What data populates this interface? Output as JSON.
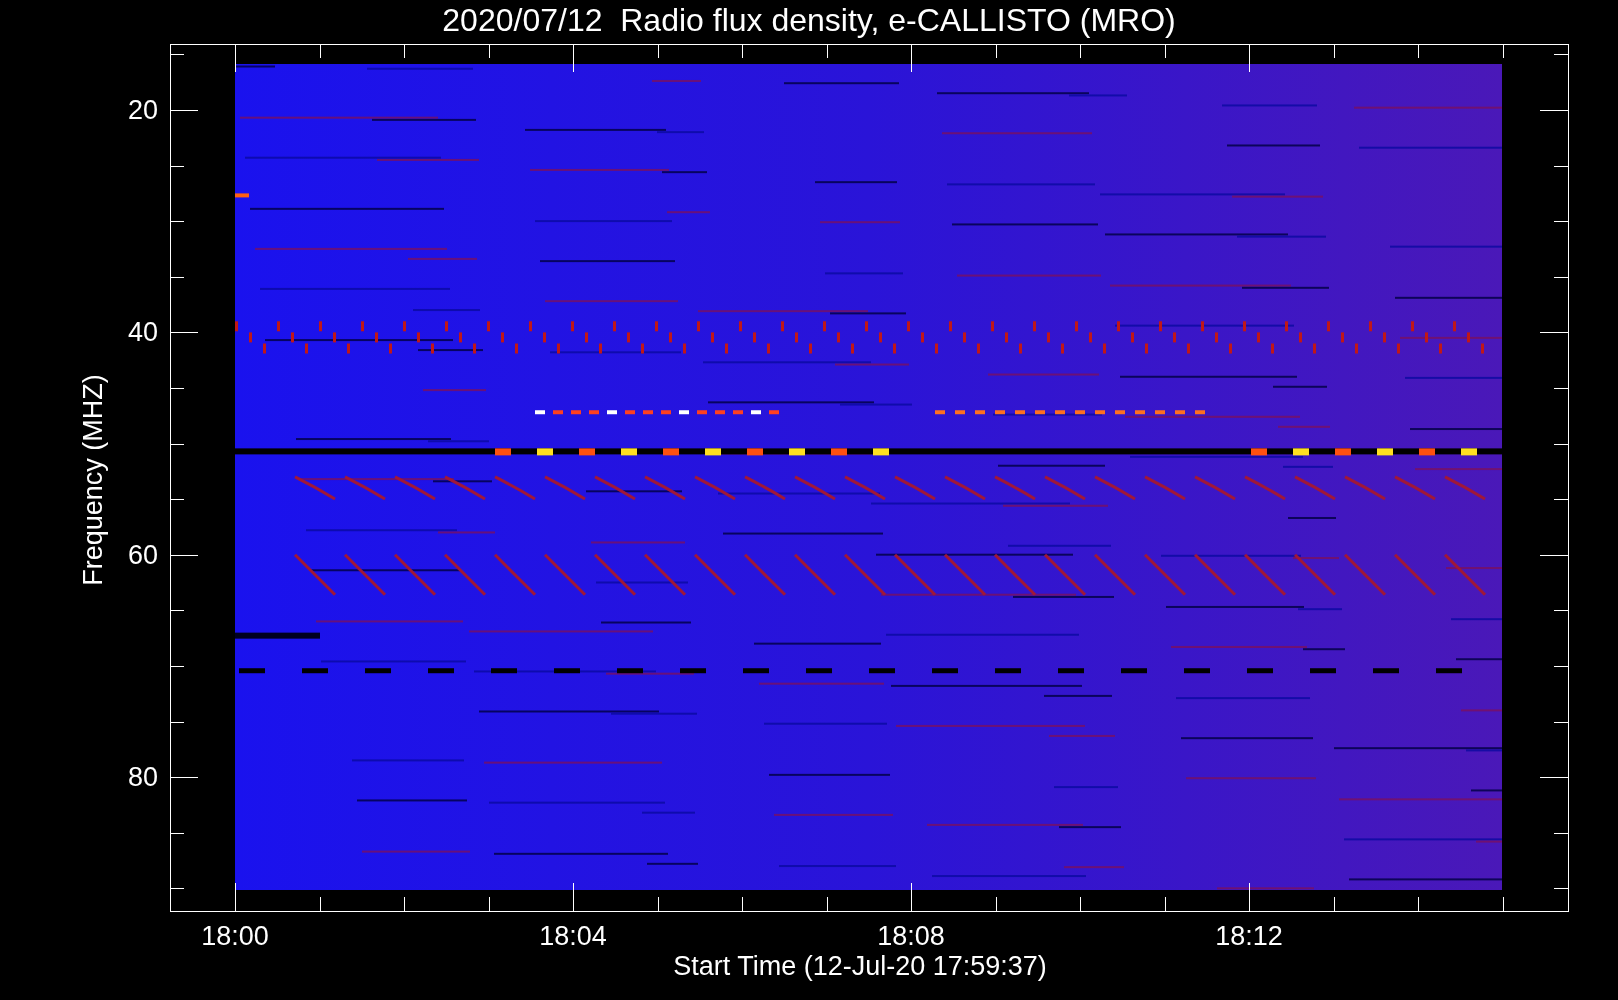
{
  "title": "2020/07/12  Radio flux density, e-CALLISTO (MRO)",
  "y_axis": {
    "label": "Frequency (MHZ)",
    "ticks": [
      "20",
      "40",
      "60",
      "80"
    ]
  },
  "x_axis": {
    "label": "Start Time (12-Jul-20 17:59:37)",
    "ticks": [
      "18:00",
      "18:04",
      "18:08",
      "18:12"
    ]
  }
}
